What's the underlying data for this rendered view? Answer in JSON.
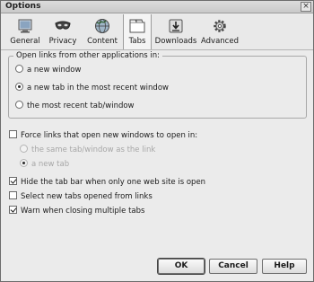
{
  "window": {
    "title": "Options",
    "close_glyph": "×"
  },
  "toolbar": {
    "items": [
      {
        "label": "General",
        "icon": "general-icon",
        "selected": false
      },
      {
        "label": "Privacy",
        "icon": "privacy-mask-icon",
        "selected": false
      },
      {
        "label": "Content",
        "icon": "content-globe-icon",
        "selected": false
      },
      {
        "label": "Tabs",
        "icon": "tabs-icon",
        "selected": true
      },
      {
        "label": "Downloads",
        "icon": "downloads-icon",
        "selected": false
      },
      {
        "label": "Advanced",
        "icon": "advanced-gear-icon",
        "selected": false
      }
    ]
  },
  "open_links": {
    "legend": "Open links from other applications in:",
    "options": [
      {
        "label": "a new window",
        "selected": false
      },
      {
        "label": "a new tab in the most recent window",
        "selected": true
      },
      {
        "label": "the most recent tab/window",
        "selected": false
      }
    ]
  },
  "force_links": {
    "label": "Force links that open new windows to open in:",
    "checked": false,
    "sub_options": [
      {
        "label": "the same tab/window as the link",
        "selected": false,
        "disabled": true
      },
      {
        "label": "a new tab",
        "selected": true,
        "disabled": true
      }
    ]
  },
  "checkboxes": [
    {
      "label": "Hide the tab bar when only one web site is open",
      "checked": true
    },
    {
      "label": "Select new tabs opened from links",
      "checked": false
    },
    {
      "label": "Warn when closing multiple tabs",
      "checked": true
    }
  ],
  "buttons": {
    "ok": "OK",
    "cancel": "Cancel",
    "help": "Help"
  }
}
